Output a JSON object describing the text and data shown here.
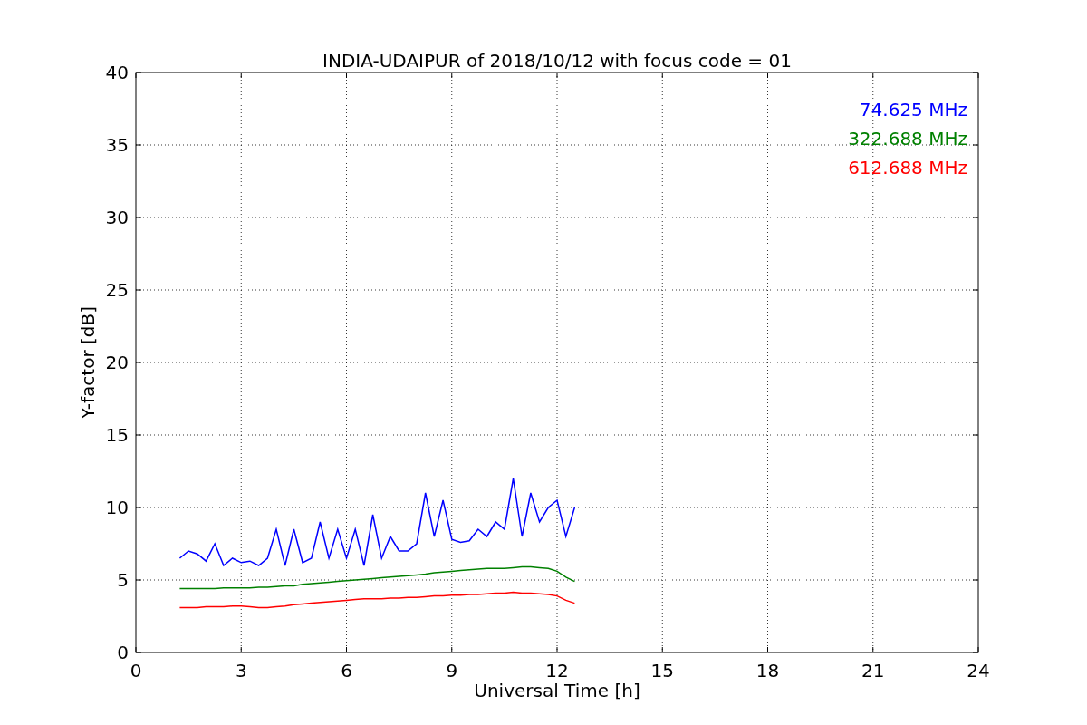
{
  "figure": {
    "chart_data": {
      "type": "line",
      "title": "INDIA-UDAIPUR of 2018/10/12 with focus code = 01",
      "xlabel": "Universal Time [h]",
      "ylabel": "Y-factor [dB]",
      "x": [
        1.25,
        1.5,
        1.75,
        2,
        2.25,
        2.5,
        2.75,
        3,
        3.25,
        3.5,
        3.75,
        4,
        4.25,
        4.5,
        4.75,
        5,
        5.25,
        5.5,
        5.75,
        6,
        6.25,
        6.5,
        6.75,
        7,
        7.25,
        7.5,
        7.75,
        8,
        8.25,
        8.5,
        8.75,
        9,
        9.25,
        9.5,
        9.75,
        10,
        10.25,
        10.5,
        10.75,
        11,
        11.25,
        11.5,
        11.75,
        12,
        12.25,
        12.5
      ],
      "series": [
        {
          "name": "74.625 MHz",
          "color": "#0000ff",
          "values": [
            6.5,
            7,
            6.8,
            6.3,
            7.5,
            6,
            6.5,
            6.2,
            6.3,
            6,
            6.5,
            8.5,
            6,
            8.5,
            6.2,
            6.5,
            9,
            6.5,
            8.5,
            6.5,
            8.5,
            6,
            9.5,
            6.5,
            8,
            7,
            7,
            7.5,
            11,
            8,
            10.5,
            7.8,
            7.6,
            7.7,
            8.5,
            8,
            9,
            8.5,
            12,
            8,
            11,
            9,
            10,
            10.5,
            8,
            10
          ]
        },
        {
          "name": "322.688 MHz",
          "color": "#008000",
          "values": [
            4.4,
            4.4,
            4.4,
            4.4,
            4.4,
            4.45,
            4.45,
            4.45,
            4.45,
            4.5,
            4.5,
            4.55,
            4.6,
            4.6,
            4.7,
            4.75,
            4.8,
            4.85,
            4.9,
            4.95,
            5.0,
            5.05,
            5.1,
            5.15,
            5.2,
            5.25,
            5.3,
            5.35,
            5.4,
            5.5,
            5.55,
            5.6,
            5.65,
            5.7,
            5.75,
            5.8,
            5.8,
            5.8,
            5.85,
            5.9,
            5.9,
            5.85,
            5.8,
            5.6,
            5.2,
            4.9
          ]
        },
        {
          "name": "612.688 MHz",
          "color": "#ff0000",
          "values": [
            3.1,
            3.1,
            3.1,
            3.15,
            3.15,
            3.15,
            3.2,
            3.2,
            3.15,
            3.1,
            3.1,
            3.15,
            3.2,
            3.3,
            3.35,
            3.4,
            3.45,
            3.5,
            3.55,
            3.6,
            3.65,
            3.7,
            3.7,
            3.7,
            3.75,
            3.75,
            3.8,
            3.8,
            3.85,
            3.9,
            3.9,
            3.95,
            3.95,
            4.0,
            4.0,
            4.05,
            4.1,
            4.1,
            4.15,
            4.1,
            4.1,
            4.05,
            4.0,
            3.9,
            3.6,
            3.4
          ]
        }
      ],
      "xlim": [
        0,
        24
      ],
      "ylim": [
        0,
        40
      ],
      "xticks": [
        0,
        3,
        6,
        9,
        12,
        15,
        18,
        21,
        24
      ],
      "yticks": [
        0,
        5,
        10,
        15,
        20,
        25,
        30,
        35,
        40
      ],
      "grid": true
    }
  }
}
